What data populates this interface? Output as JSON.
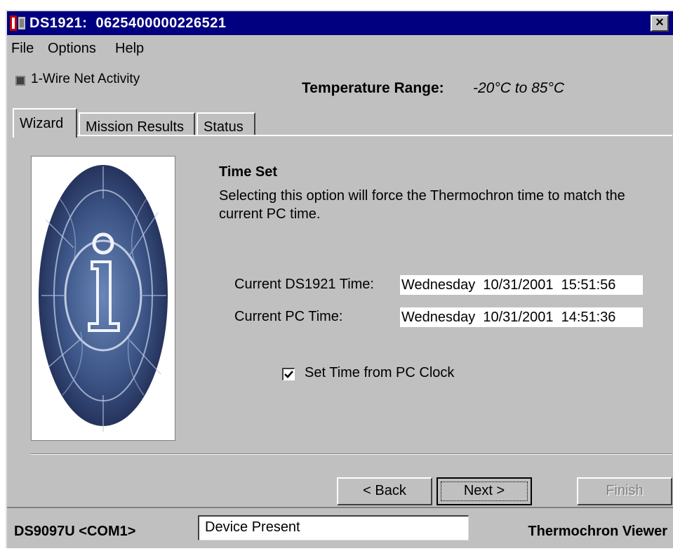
{
  "window": {
    "title": "DS1921:  0625400000226521",
    "close_glyph": "×"
  },
  "menu": [
    {
      "label": "File"
    },
    {
      "label": "Options"
    },
    {
      "label": "Help"
    }
  ],
  "toolbar": {
    "activity_label": "1-Wire Net Activity",
    "temp_range_label": "Temperature Range:",
    "temp_range_value": "-20°C to 85°C"
  },
  "tabs": [
    {
      "label": "Wizard",
      "active": true
    },
    {
      "label": "Mission Results",
      "active": false
    },
    {
      "label": "Status",
      "active": false
    }
  ],
  "wizard": {
    "image_icon": "ibutton-logo-image",
    "section_title": "Time Set",
    "section_desc": "Selecting this option will force the Thermochron time to match the current PC time.",
    "device_time_label": "Current DS1921 Time:",
    "device_time_value": "Wednesday  10/31/2001  15:51:56",
    "pc_time_label": "Current PC Time:",
    "pc_time_value": "Wednesday  10/31/2001  14:51:36",
    "checkbox_label": "Set Time from PC Clock",
    "checkbox_checked": true
  },
  "buttons": {
    "back": "< Back",
    "next": "Next >",
    "finish": "Finish"
  },
  "statusbar": {
    "adapter": "DS9097U <COM1>",
    "device_status": "Device Present",
    "app_name": "Thermochron Viewer"
  }
}
